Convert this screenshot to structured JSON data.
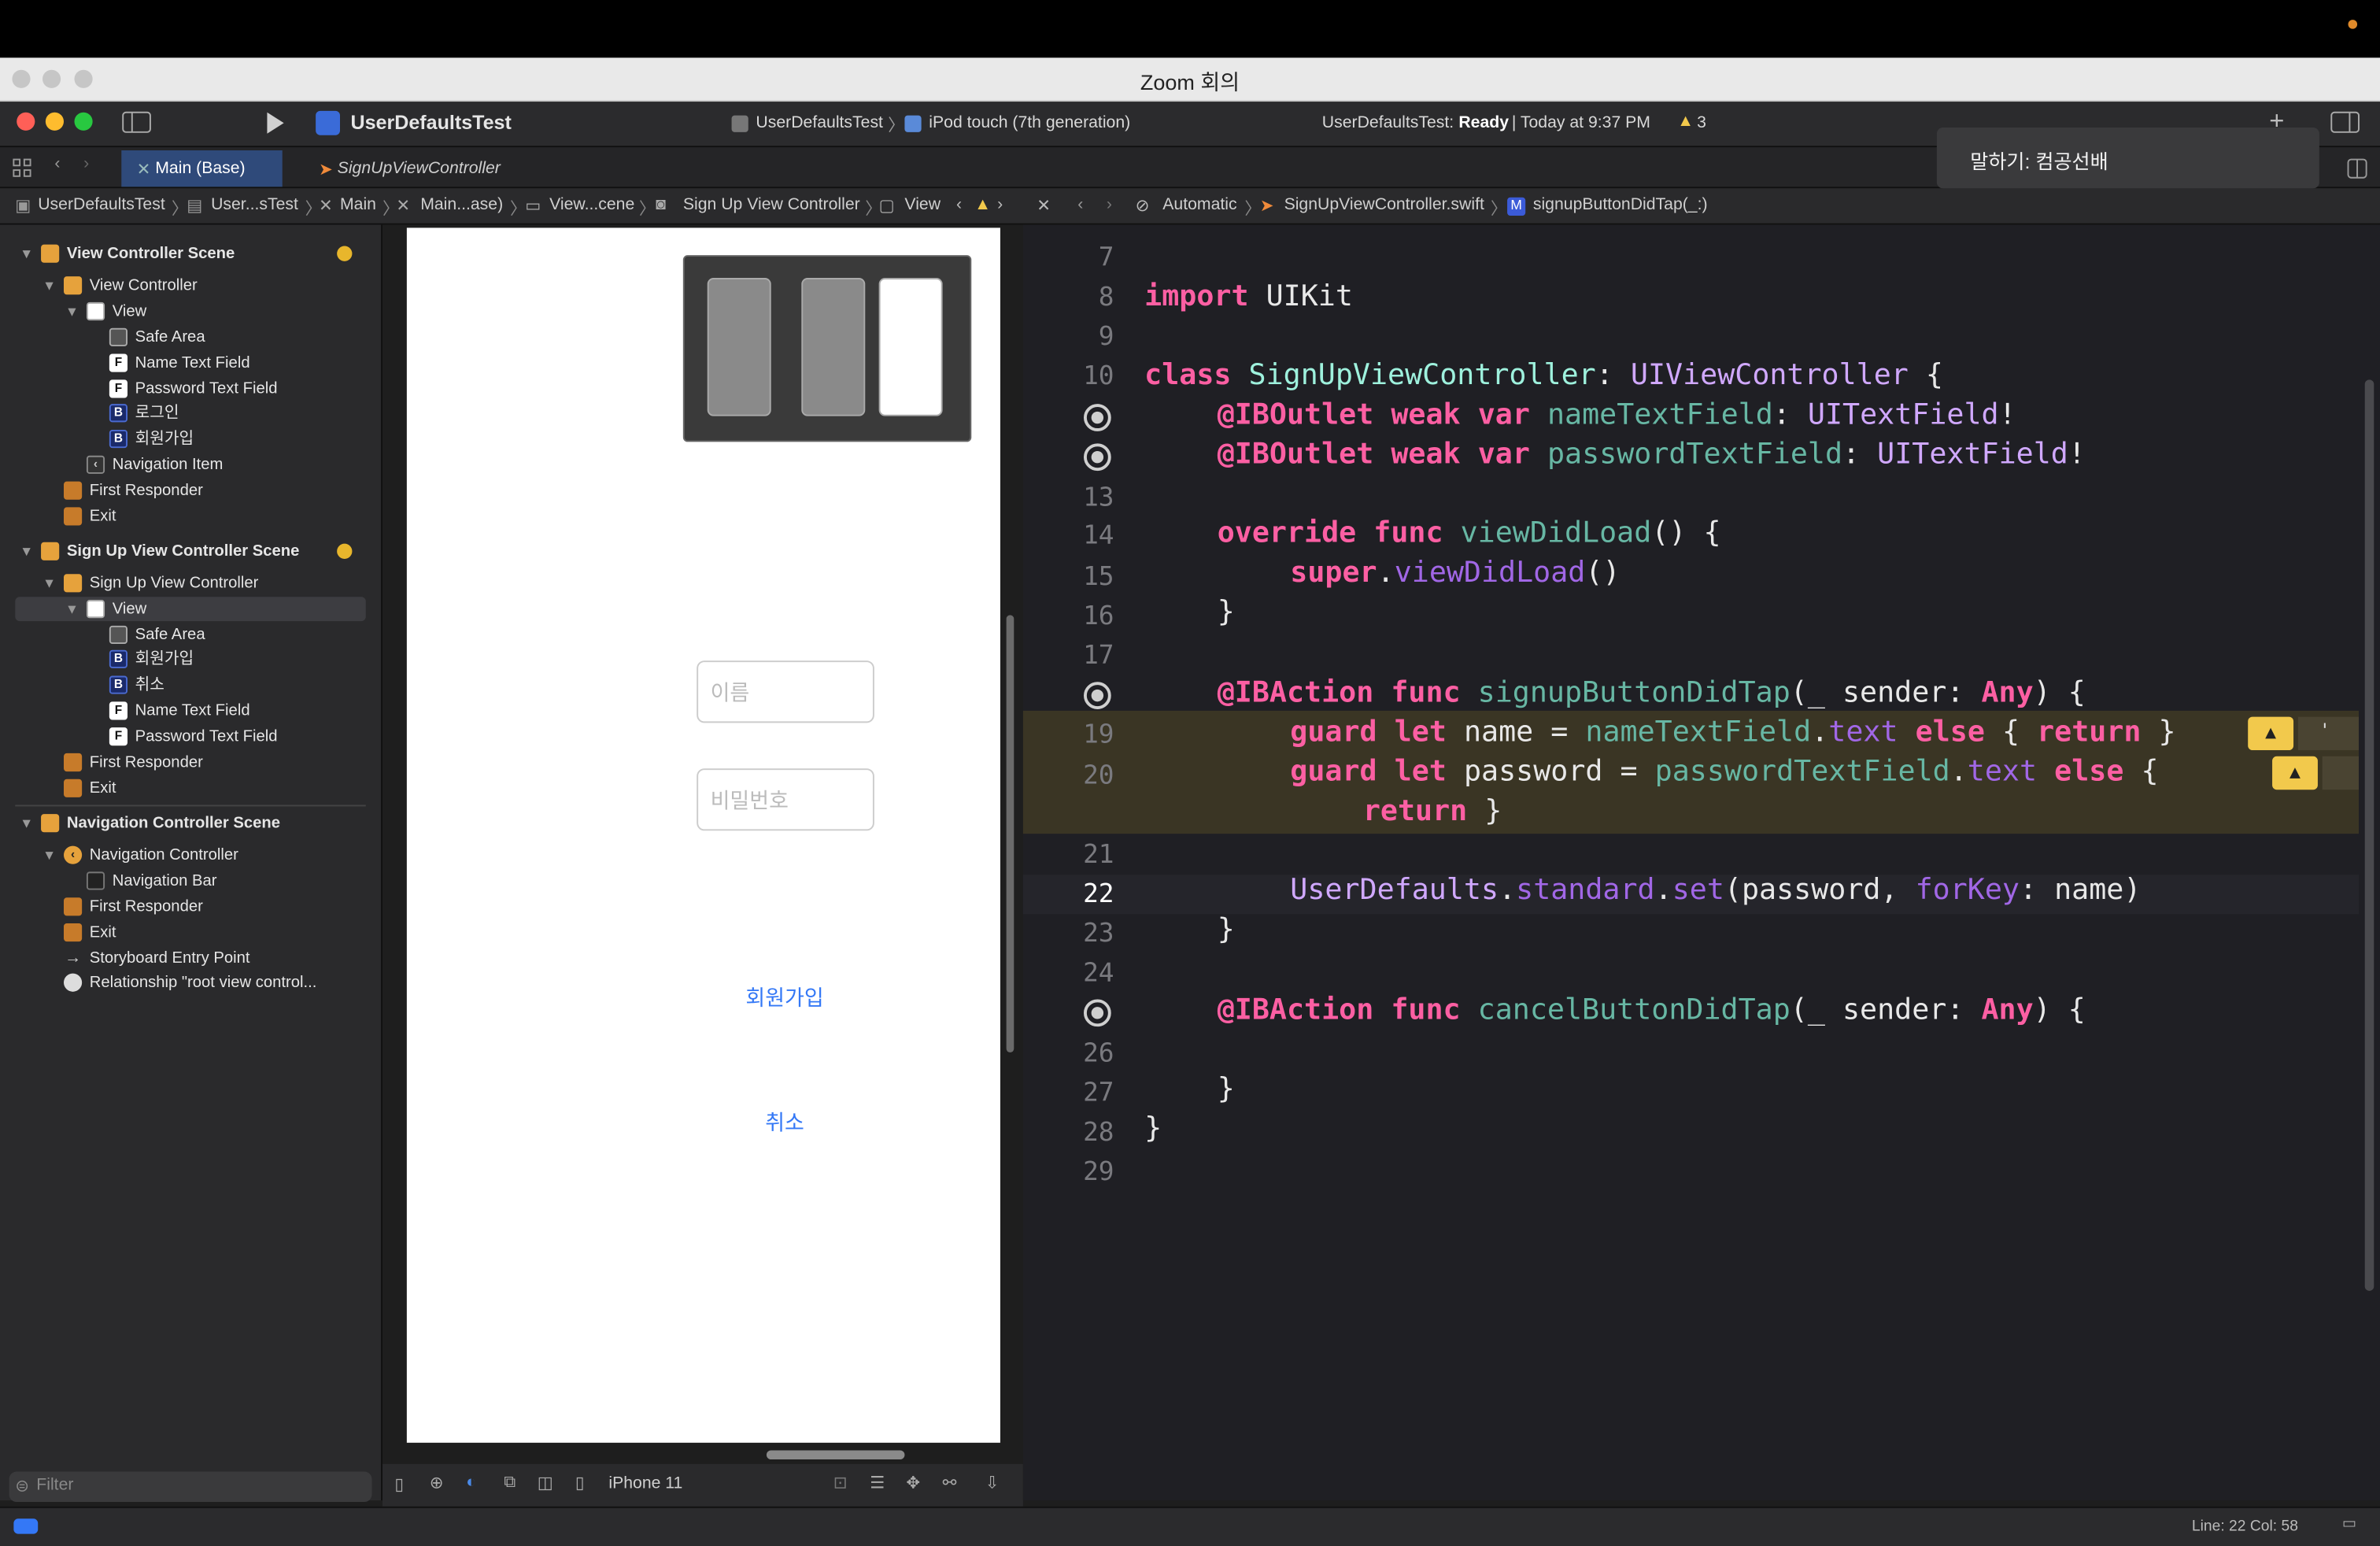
{
  "zoom": {
    "window_title": "Zoom 회의",
    "speaking_label": "말하기: 컴공선배"
  },
  "toolbar": {
    "scheme": "UserDefaultsTest",
    "target_app": "UserDefaultsTest",
    "target_device": "iPod touch (7th generation)",
    "status_prefix": "UserDefaultsTest:",
    "status_bold": "Ready",
    "status_suffix": "| Today at 9:37 PM",
    "warning_count": "3",
    "add_icon": "+"
  },
  "tabs": [
    {
      "label": "Main (Base)"
    },
    {
      "label": "SignUpViewController"
    }
  ],
  "jumpbar_left": [
    "UserDefaultsTest",
    "User...sTest",
    "Main",
    "Main...ase)",
    "View...cene",
    "Sign Up View Controller",
    "View"
  ],
  "jumpbar_right": [
    "Automatic",
    "SignUpViewController.swift",
    "signupButtonDidTap(_:)"
  ],
  "navigator": {
    "items": [
      {
        "label": "View Controller Scene"
      },
      {
        "label": "View Controller"
      },
      {
        "label": "View"
      },
      {
        "label": "Safe Area"
      },
      {
        "label": "Name Text Field"
      },
      {
        "label": "Password Text Field"
      },
      {
        "label": "로그인"
      },
      {
        "label": "회원가입"
      },
      {
        "label": "Navigation Item"
      },
      {
        "label": "First Responder"
      },
      {
        "label": "Exit"
      },
      {
        "label": "Sign Up View Controller Scene"
      },
      {
        "label": "Sign Up View Controller"
      },
      {
        "label": "View"
      },
      {
        "label": "Safe Area"
      },
      {
        "label": "회원가입"
      },
      {
        "label": "취소"
      },
      {
        "label": "Name Text Field"
      },
      {
        "label": "Password Text Field"
      },
      {
        "label": "First Responder"
      },
      {
        "label": "Exit"
      },
      {
        "label": "Navigation Controller Scene"
      },
      {
        "label": "Navigation Controller"
      },
      {
        "label": "Navigation Bar"
      },
      {
        "label": "First Responder"
      },
      {
        "label": "Exit"
      },
      {
        "label": "Storyboard Entry Point"
      },
      {
        "label": "Relationship \"root view control..."
      }
    ],
    "filter_placeholder": "Filter"
  },
  "canvas": {
    "name_placeholder": "이름",
    "password_placeholder": "비밀번호",
    "signup_button": "회원가입",
    "cancel_button": "취소",
    "device": "iPhone 11"
  },
  "code": {
    "line_numbers": [
      "7",
      "8",
      "9",
      "10",
      "13",
      "14",
      "15",
      "16",
      "17",
      "19",
      "20",
      "21",
      "22",
      "23",
      "24",
      "26",
      "27",
      "28",
      "29"
    ],
    "lines": {
      "l8": [
        "import",
        " UIKit"
      ],
      "l10": [
        "class",
        " SignUpViewController",
        ": ",
        "UIViewController",
        " {"
      ],
      "l11": [
        "@IBOutlet",
        " ",
        "weak",
        " ",
        "var",
        " nameTextField",
        ": ",
        "UITextField",
        "!"
      ],
      "l12": [
        "@IBOutlet",
        " ",
        "weak",
        " ",
        "var",
        " passwordTextField",
        ": ",
        "UITextField",
        "!"
      ],
      "l14": [
        "override",
        " ",
        "func",
        " viewDidLoad",
        "() {"
      ],
      "l15": [
        "super",
        ".",
        "viewDidLoad",
        "()"
      ],
      "l16": [
        "}"
      ],
      "l18": [
        "@IBAction",
        " ",
        "func",
        " signupButtonDidTap",
        "(_ sender: ",
        "Any",
        ") {"
      ],
      "l19": [
        "guard",
        " ",
        "let",
        " name = ",
        "nameTextField",
        ".",
        "text",
        " ",
        "else",
        " { ",
        "return",
        " }"
      ],
      "l20": [
        "guard",
        " ",
        "let",
        " password = ",
        "passwordTextField",
        ".",
        "text",
        " ",
        "else",
        " {"
      ],
      "l20b": [
        "return",
        " }"
      ],
      "l22": [
        "UserDefaults",
        ".",
        "standard",
        ".",
        "set",
        "(password, ",
        "forKey",
        ": name)"
      ],
      "l23": [
        "}"
      ],
      "l25": [
        "@IBAction",
        " ",
        "func",
        " cancelButtonDidTap",
        "(_ sender: ",
        "Any",
        ") {"
      ],
      "l27": [
        "}"
      ],
      "l28": [
        "}"
      ]
    }
  },
  "status": {
    "position": "Line: 22  Col: 58"
  }
}
